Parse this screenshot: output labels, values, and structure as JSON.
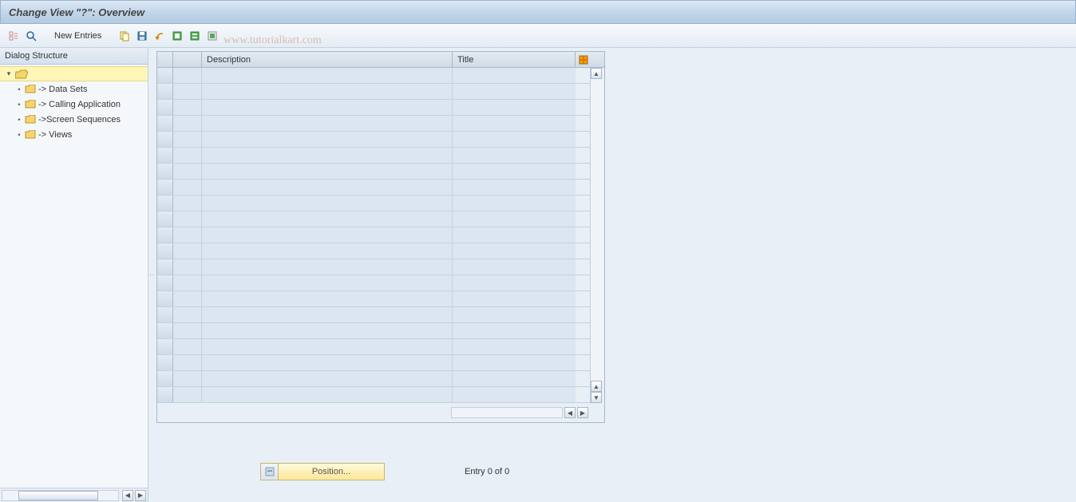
{
  "title": "Change View \"?\": Overview",
  "toolbar": {
    "new_entries_label": "New Entries"
  },
  "watermark": "www.tutorialkart.com",
  "sidebar": {
    "header": "Dialog Structure",
    "items": [
      {
        "label": "-> Data Sets"
      },
      {
        "label": "-> Calling Application"
      },
      {
        "label": "->Screen Sequences"
      },
      {
        "label": "-> Views"
      }
    ]
  },
  "grid": {
    "columns": {
      "description": "Description",
      "title": "Title"
    }
  },
  "position_button_label": "Position...",
  "entry_status": "Entry 0 of 0"
}
